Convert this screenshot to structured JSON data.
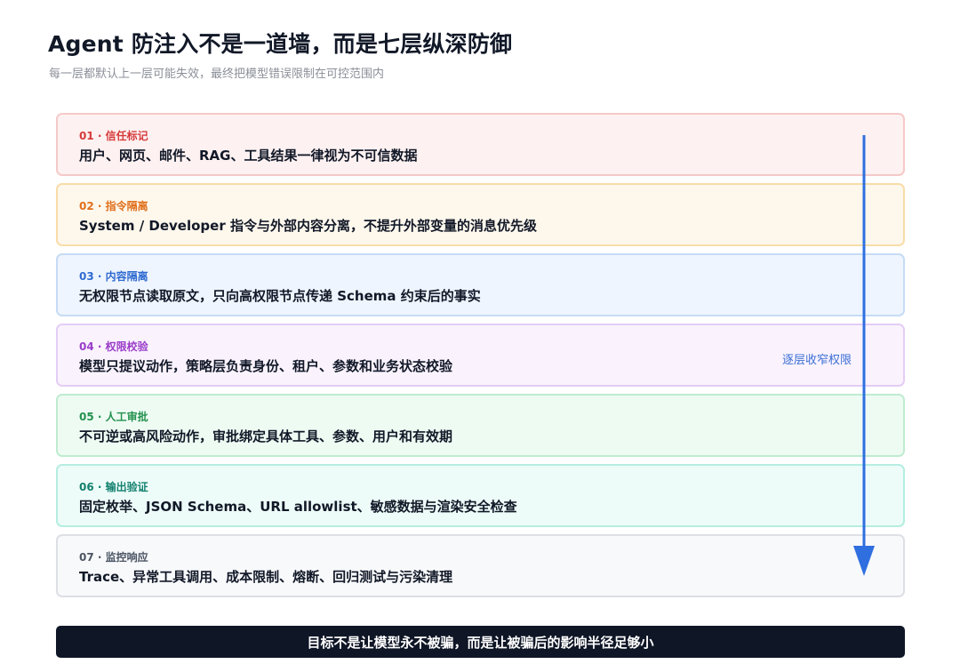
{
  "header": {
    "title": "Agent 防注入不是一道墙，而是七层纵深防御",
    "subtitle": "每一层都默认上一层可能失效，最终把模型错误限制在可控范围内"
  },
  "layers": [
    {
      "label": "01 · 信任标记",
      "desc": "用户、网页、邮件、RAG、工具结果一律视为不可信数据",
      "bg": "#fdf1f1",
      "border": "#f6c9c9",
      "accent": "#d63b3b"
    },
    {
      "label": "02 · 指令隔离",
      "desc": "System / Developer 指令与外部内容分离，不提升外部变量的消息优先级",
      "bg": "#fef7ec",
      "border": "#f9dca8",
      "accent": "#e0701c"
    },
    {
      "label": "03 · 内容隔离",
      "desc": "无权限节点读取原文，只向高权限节点传递 Schema 约束后的事实",
      "bg": "#eff5fe",
      "border": "#c6dbf6",
      "accent": "#2f6bd0"
    },
    {
      "label": "04 · 权限校验",
      "desc": "模型只提议动作，策略层负责身份、租户、参数和业务状态校验",
      "bg": "#faf3fe",
      "border": "#e4cdf6",
      "accent": "#9a3cc9"
    },
    {
      "label": "05 · 人工审批",
      "desc": "不可逆或高风险动作，审批绑定具体工具、参数、用户和有效期",
      "bg": "#eefbf3",
      "border": "#bfeccf",
      "accent": "#23914e"
    },
    {
      "label": "06 · 输出验证",
      "desc": "固定枚举、JSON Schema、URL allowlist、敏感数据与渲染安全检查",
      "bg": "#edfcf9",
      "border": "#b5ede1",
      "accent": "#14806f"
    },
    {
      "label": "07 · 监控响应",
      "desc": "Trace、异常工具调用、成本限制、熔断、回归测试与污染清理",
      "bg": "#f8f9fb",
      "border": "#dcdfe4",
      "accent": "#4b5563"
    }
  ],
  "side_label": "逐层收窄权限",
  "footer": {
    "text": "目标不是让模型永不被骗，而是让被骗后的影响半径足够小"
  },
  "arrow_icon": "arrow-down-icon",
  "arrow_color": "#2f6fe0"
}
